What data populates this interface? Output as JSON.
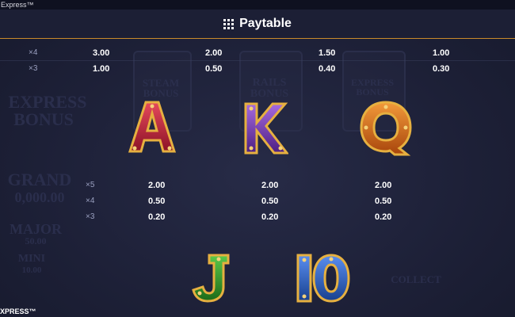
{
  "app": {
    "title": "Express™"
  },
  "header": {
    "title": "Paytable",
    "menu_icon": "grid-menu-icon",
    "accent_color": "#c98a2a"
  },
  "top_table": {
    "rows": [
      {
        "multiplier": "×4",
        "values": [
          "3.00",
          "2.00",
          "1.50",
          "1.00"
        ]
      },
      {
        "multiplier": "×3",
        "values": [
          "1.00",
          "0.50",
          "0.40",
          "0.30"
        ]
      }
    ]
  },
  "symbols_row1": [
    {
      "letter": "A",
      "color": "#c0223a"
    },
    {
      "letter": "K",
      "color": "#7a3fb0"
    },
    {
      "letter": "Q",
      "color": "#d4781e"
    }
  ],
  "pay_table": {
    "multipliers": [
      "×5",
      "×4",
      "×3"
    ],
    "columns": [
      [
        "2.00",
        "0.50",
        "0.20"
      ],
      [
        "2.00",
        "0.50",
        "0.20"
      ],
      [
        "2.00",
        "0.50",
        "0.20"
      ]
    ]
  },
  "symbols_row2": [
    {
      "letter": "J",
      "color": "#2f9a2a"
    },
    {
      "letter": "IO",
      "color": "#2f63c4"
    }
  ],
  "background_text": {
    "steam_bonus": "STEAM BONUS",
    "rails_bonus": "RAILS BONUS",
    "express_bonus_a": "EXPRESS",
    "express_bonus_b": "BONUS",
    "express_bonus_c": "EXPRESS BONUS",
    "grand": "GRAND",
    "grand_value": "0,000.00",
    "major": "MAJOR",
    "major_value": "50.00",
    "mini": "MINI",
    "mini_value": "10.00",
    "collect": "COLLECT"
  },
  "footer": {
    "brand": "XPRESS™"
  }
}
